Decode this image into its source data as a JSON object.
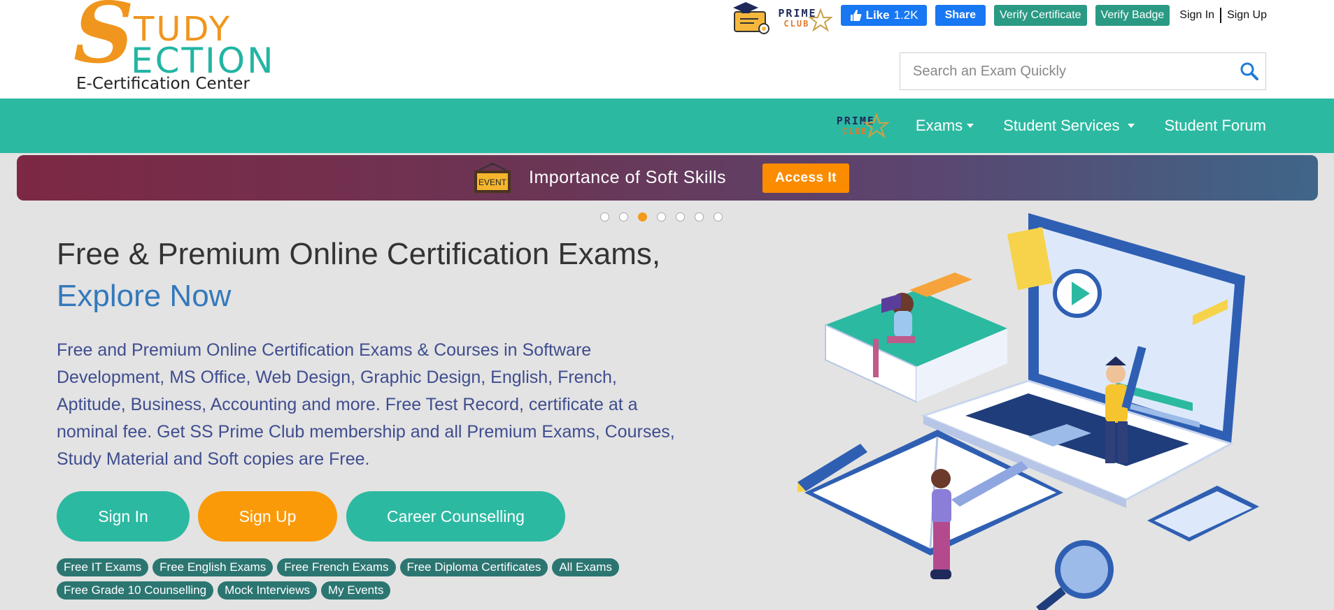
{
  "brand": {
    "logo_big_letter": "S",
    "logo_line1": "TUDY",
    "logo_line2": "ECTION",
    "tagline": "E-Certification Center"
  },
  "topbar": {
    "prime_line1": "PRIME",
    "prime_line2": "CLUB",
    "fb_like_label": "Like",
    "fb_like_count": "1.2K",
    "fb_share_label": "Share",
    "verify_certificate": "Verify Certificate",
    "verify_badge": "Verify Badge",
    "sign_in": "Sign In",
    "sign_up": "Sign Up"
  },
  "search": {
    "placeholder": "Search an Exam Quickly",
    "icon": "search-icon"
  },
  "nav": {
    "prime_line1": "PRIME",
    "prime_line2": "CLUB",
    "items": [
      {
        "label": "Exams",
        "dropdown": true
      },
      {
        "label": "Student Services",
        "dropdown": true
      },
      {
        "label": "Student Forum",
        "dropdown": false
      }
    ]
  },
  "event_banner": {
    "sign_text": "EVENT",
    "title": "Importance of Soft Skills",
    "button": "Access It"
  },
  "carousel": {
    "count": 7,
    "active_index": 2
  },
  "hero": {
    "title_line1": "Free & Premium Online Certification Exams,",
    "title_line2": "Explore Now",
    "description": "Free and Premium Online Certification Exams & Courses in Software Development, MS Office, Web Design, Graphic Design, English, French, Aptitude, Business, Accounting and more. Free Test Record, certificate at a nominal fee. Get SS Prime Club membership and all Premium Exams, Courses, Study Material and Soft copies are Free.",
    "buttons": {
      "sign_in": "Sign In",
      "sign_up": "Sign Up",
      "career": "Career Counselling"
    },
    "tags": [
      "Free IT Exams",
      "Free English Exams",
      "Free French Exams",
      "Free Diploma Certificates",
      "All Exams",
      "Free Grade 10 Counselling",
      "Mock Interviews",
      "My Events"
    ]
  },
  "colors": {
    "teal": "#2cb9a1",
    "orange": "#fb9a08",
    "dark_teal_tag": "#2c7672",
    "hero_link_blue": "#3479bb"
  }
}
